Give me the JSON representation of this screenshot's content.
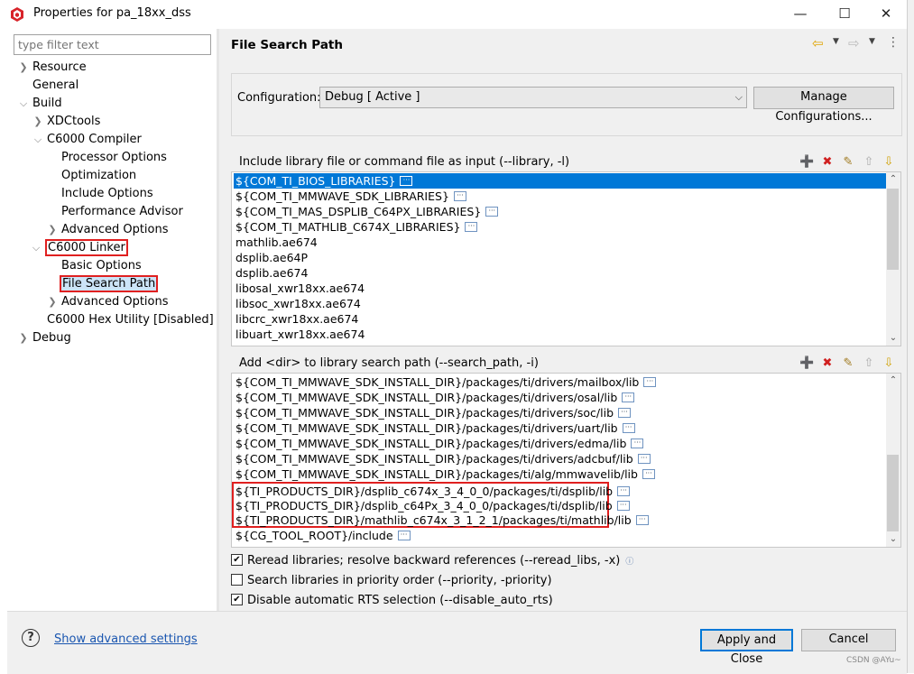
{
  "window": {
    "title": "Properties for pa_18xx_dss",
    "minimize": "—",
    "maximize": "☐",
    "close": "✕"
  },
  "filter": {
    "placeholder": "type filter text"
  },
  "tree": [
    {
      "label": "Resource"
    },
    {
      "label": "General"
    },
    {
      "label": "Build"
    },
    {
      "label": "XDCtools"
    },
    {
      "label": "C6000 Compiler"
    },
    {
      "label": "Processor Options"
    },
    {
      "label": "Optimization"
    },
    {
      "label": "Include Options"
    },
    {
      "label": "Performance Advisor"
    },
    {
      "label": "Advanced Options"
    },
    {
      "label": "C6000 Linker"
    },
    {
      "label": "Basic Options"
    },
    {
      "label": "File Search Path"
    },
    {
      "label": "Advanced Options"
    },
    {
      "label": "C6000 Hex Utility  [Disabled]"
    },
    {
      "label": "Debug"
    }
  ],
  "page": {
    "title": "File Search Path"
  },
  "config": {
    "label": "Configuration:",
    "value": "Debug  [ Active ]",
    "manage_button": "Manage Configurations..."
  },
  "libraries": {
    "header": "Include library file or command file as input (--library, -l)",
    "items": [
      "${COM_TI_BIOS_LIBRARIES}",
      "${COM_TI_MMWAVE_SDK_LIBRARIES}",
      "${COM_TI_MAS_DSPLIB_C64PX_LIBRARIES}",
      "${COM_TI_MATHLIB_C674X_LIBRARIES}",
      "mathlib.ae674",
      "dsplib.ae64P",
      "dsplib.ae674",
      "libosal_xwr18xx.ae674",
      "libsoc_xwr18xx.ae674",
      "libcrc_xwr18xx.ae674",
      "libuart_xwr18xx.ae674"
    ]
  },
  "search_paths": {
    "header": "Add <dir> to library search path (--search_path, -i)",
    "items": [
      "${COM_TI_MMWAVE_SDK_INSTALL_DIR}/packages/ti/drivers/mailbox/lib",
      "${COM_TI_MMWAVE_SDK_INSTALL_DIR}/packages/ti/drivers/osal/lib",
      "${COM_TI_MMWAVE_SDK_INSTALL_DIR}/packages/ti/drivers/soc/lib",
      "${COM_TI_MMWAVE_SDK_INSTALL_DIR}/packages/ti/drivers/uart/lib",
      "${COM_TI_MMWAVE_SDK_INSTALL_DIR}/packages/ti/drivers/edma/lib",
      "${COM_TI_MMWAVE_SDK_INSTALL_DIR}/packages/ti/drivers/adcbuf/lib",
      "${COM_TI_MMWAVE_SDK_INSTALL_DIR}/packages/ti/alg/mmwavelib/lib",
      "${TI_PRODUCTS_DIR}/dsplib_c674x_3_4_0_0/packages/ti/dsplib/lib",
      "${TI_PRODUCTS_DIR}/dsplib_c64Px_3_4_0_0/packages/ti/dsplib/lib",
      "${TI_PRODUCTS_DIR}/mathlib_c674x_3_1_2_1/packages/ti/mathlib/lib",
      "${CG_TOOL_ROOT}/include"
    ]
  },
  "options": {
    "reread": {
      "label": "Reread libraries; resolve backward references (--reread_libs, -x)",
      "checked": true
    },
    "priority": {
      "label": "Search libraries in priority order (--priority, -priority)",
      "checked": false
    },
    "disable_rts": {
      "label": "Disable automatic RTS selection (--disable_auto_rts)",
      "checked": true
    }
  },
  "footer": {
    "advanced_link": "Show advanced settings",
    "apply_button": "Apply and Close",
    "cancel_button": "Cancel",
    "help": "?"
  },
  "watermark": "CSDN @AYu~",
  "colors": {
    "selection": "#0078d7",
    "highlight_border": "#e02020",
    "link": "#1a56b0"
  }
}
